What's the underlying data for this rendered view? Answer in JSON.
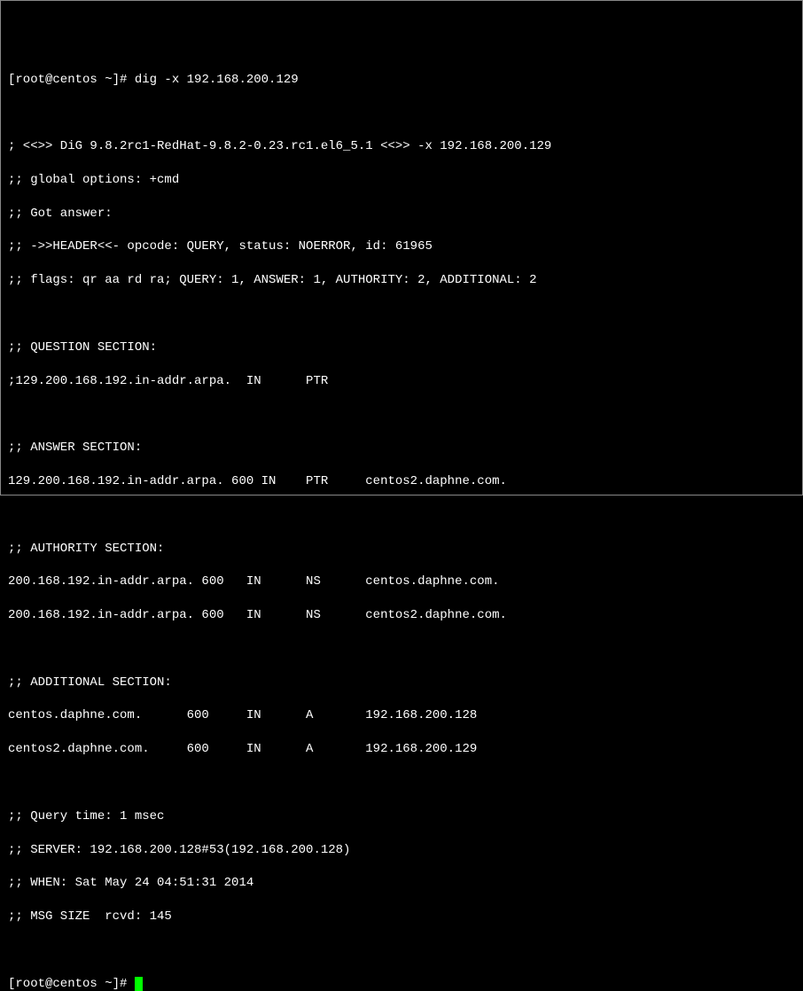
{
  "prompt1": {
    "prefix": "[root@centos ~]# ",
    "command": "dig -x 192.168.200.129"
  },
  "output": {
    "evermine": "; <<>> DiG 9.8.2rc1-RedHat-9.8.2-0.23.rc1.el6_5.1 <<>> -x 192.168.200.129",
    "global_options": ";; global options: +cmd",
    "got_answer": ";; Got answer:",
    "header": ";; ->>HEADER<<- opcode: QUERY, status: NOERROR, id: 61965",
    "flags": ";; flags: qr aa rd ra; QUERY: 1, ANSWER: 1, AUTHORITY: 2, ADDITIONAL: 2",
    "question_header": ";; QUESTION SECTION:",
    "question_line": ";129.200.168.192.in-addr.arpa.  IN      PTR",
    "answer_header": ";; ANSWER SECTION:",
    "answer_line": "129.200.168.192.in-addr.arpa. 600 IN    PTR     centos2.daphne.com.",
    "authority_header": ";; AUTHORITY SECTION:",
    "authority_line1": "200.168.192.in-addr.arpa. 600   IN      NS      centos.daphne.com.",
    "authority_line2": "200.168.192.in-addr.arpa. 600   IN      NS      centos2.daphne.com.",
    "additional_header": ";; ADDITIONAL SECTION:",
    "additional_line1": "centos.daphne.com.      600     IN      A       192.168.200.128",
    "additional_line2": "centos2.daphne.com.     600     IN      A       192.168.200.129",
    "query_time": ";; Query time: 1 msec",
    "server": ";; SERVER: 192.168.200.128#53(192.168.200.128)",
    "when": ";; WHEN: Sat May 24 04:51:31 2014",
    "msg_size": ";; MSG SIZE  rcvd: 145"
  },
  "prompt2": {
    "prefix": "[root@centos ~]# "
  }
}
